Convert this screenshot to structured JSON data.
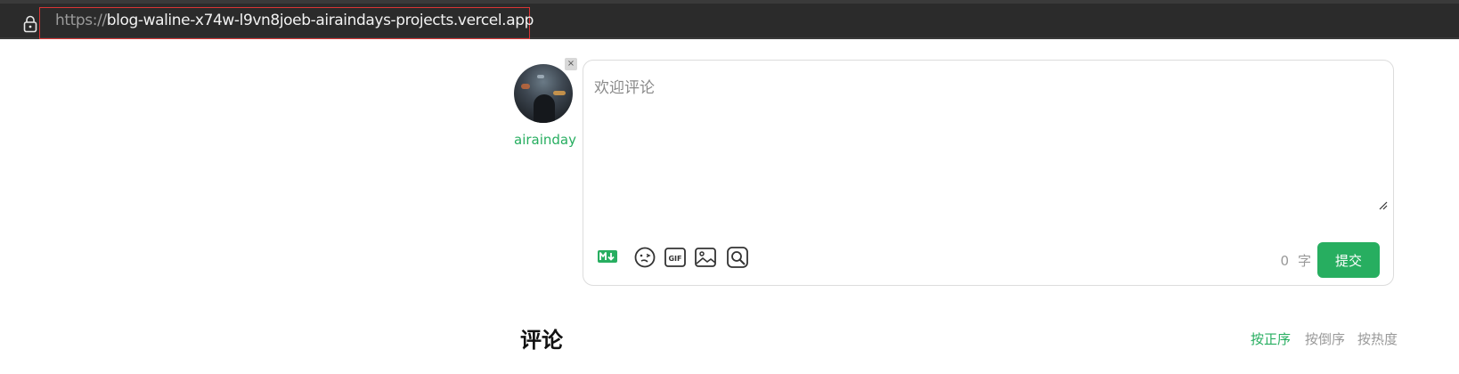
{
  "browser": {
    "url_scheme": "https://",
    "url_host": "blog-waline-x74w-l9vn8joeb-airaindays-projects.vercel.app"
  },
  "comment_form": {
    "close_symbol": "×",
    "nickname": "airainday",
    "placeholder": "欢迎评论",
    "tools": [
      "markdown-icon",
      "emoji-icon",
      "gif-icon",
      "image-icon",
      "search-icon"
    ],
    "word_count_value": "0",
    "word_count_unit": "字",
    "submit_label": "提交",
    "accent_color": "#27ae60"
  },
  "comments": {
    "title": "评论",
    "sort_options": [
      {
        "label": "按正序",
        "active": true
      },
      {
        "label": "按倒序",
        "active": false
      },
      {
        "label": "按热度",
        "active": false
      }
    ]
  }
}
